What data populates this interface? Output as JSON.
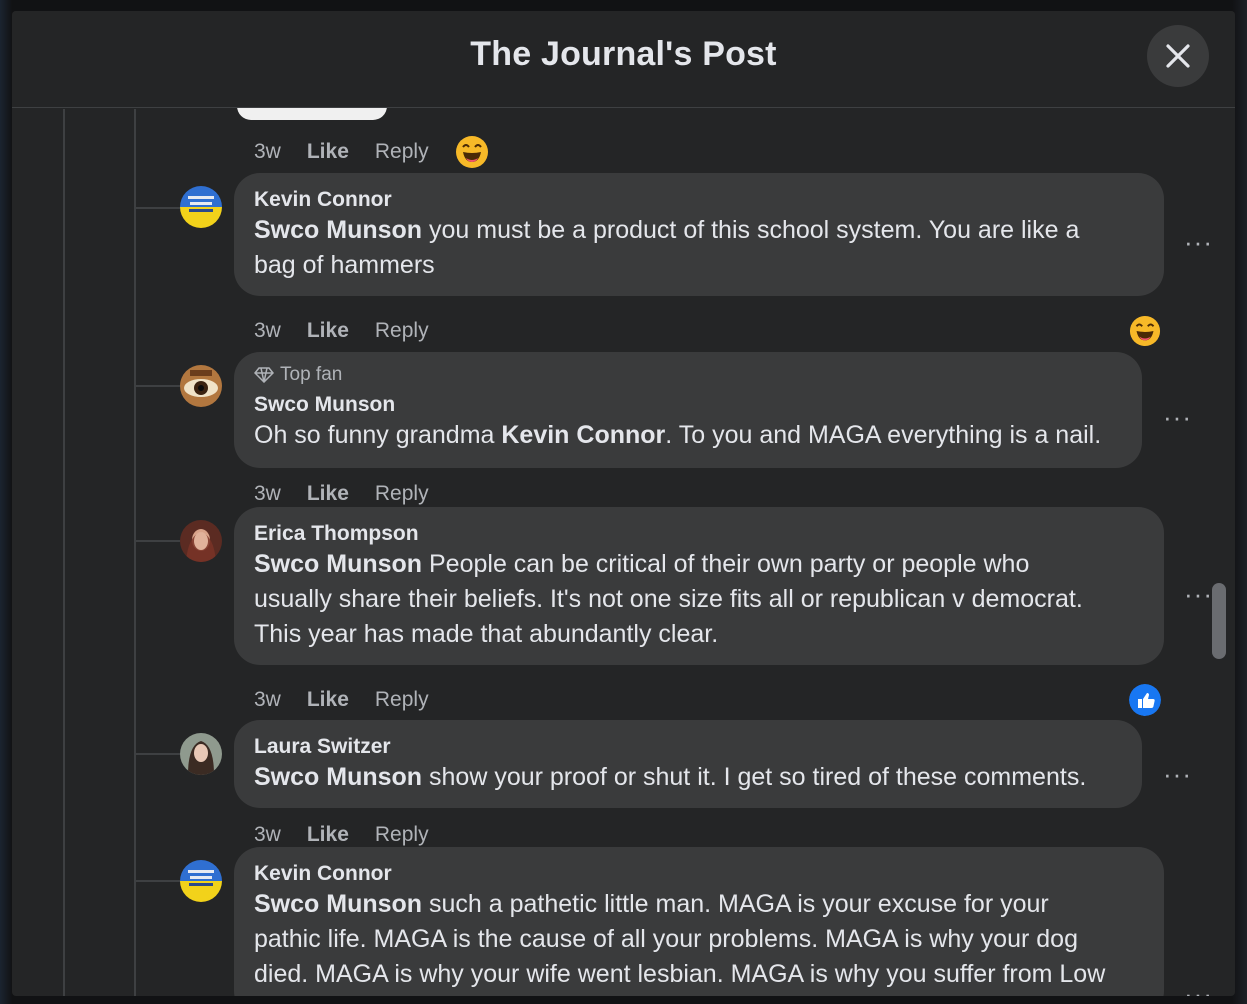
{
  "dialog": {
    "title": "The Journal's Post"
  },
  "top_meta": {
    "time": "3w",
    "like": "Like",
    "reply": "Reply"
  },
  "comments": [
    {
      "author": "Kevin Connor",
      "mention": "Swco Munson",
      "text_line1": " you must be a product of this school system. You are like a",
      "text_line2": "bag of hammers",
      "time": "3w",
      "like": "Like",
      "reply": "Reply"
    },
    {
      "badge": "Top fan",
      "author": "Swco Munson",
      "text_before": "Oh so funny grandma ",
      "mention": "Kevin Connor",
      "text_after": ". To you and MAGA everything is a nail.",
      "time": "3w",
      "like": "Like",
      "reply": "Reply"
    },
    {
      "author": "Erica Thompson",
      "mention": "Swco Munson",
      "text_line1": " People can be critical of their own party or people who",
      "text_line2": "usually share their beliefs. It's not one size fits all or republican v democrat.",
      "text_line3": "This year has made that abundantly clear.",
      "time": "3w",
      "like": "Like",
      "reply": "Reply"
    },
    {
      "author": "Laura Switzer",
      "mention": "Swco Munson",
      "text_line1": " show your proof or shut it. I get so tired of these comments.",
      "time": "3w",
      "like": "Like",
      "reply": "Reply"
    },
    {
      "author": "Kevin Connor",
      "mention": "Swco Munson",
      "text_line1": " such a pathetic little man. MAGA is your excuse for your",
      "text_line2": "pathic life. MAGA is the cause of all your problems. MAGA is why your dog",
      "text_line3": "died. MAGA is why your wife went lesbian. MAGA is why you suffer from Low"
    }
  ],
  "more_label": "···",
  "colors": {
    "bg": "#242526",
    "bubble": "#3a3b3c",
    "text": "#e4e6eb",
    "muted": "#b0b3b8",
    "like_blue": "#1877f2"
  }
}
